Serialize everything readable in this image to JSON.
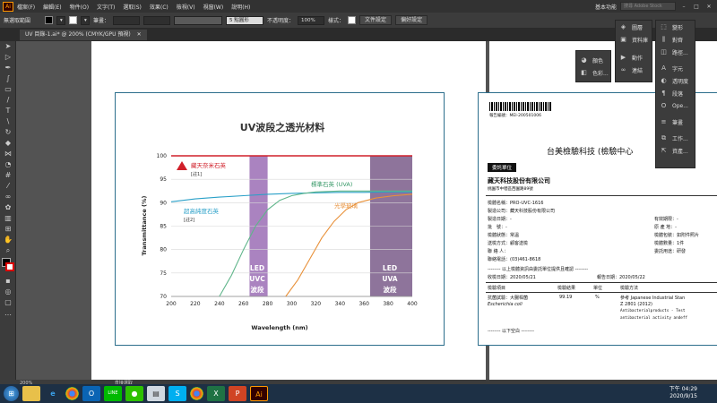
{
  "menubar": {
    "logo": "Ai",
    "items": [
      "檔案(F)",
      "編輯(E)",
      "物件(O)",
      "文字(T)",
      "選取(S)",
      "效果(C)",
      "檢視(V)",
      "視窗(W)",
      "說明(H)"
    ],
    "workspace": "基本功能",
    "search_placeholder": "搜尋 Adobe Stock",
    "win_min": "–",
    "win_max": "□",
    "win_close": "✕"
  },
  "control_bar": {
    "selection_label": "無選取範圍",
    "stroke_label": "筆畫：",
    "brush_value": "5 點圓形",
    "opacity_label": "不透明度：",
    "opacity_value": "100%",
    "style_label": "樣式：",
    "doc_setup": "文件設定",
    "preferences": "偏好設定"
  },
  "document_tab": {
    "title": "UV 目錄-1.ai* @ 200% (CMYK/GPU 預視)",
    "close": "✕"
  },
  "status_bar": {
    "zoom": "200%",
    "tool": "直接選取"
  },
  "panels": {
    "top_dock": {
      "items": [
        {
          "icon": "layers-icon",
          "label": "圖層"
        },
        {
          "icon": "library-icon",
          "label": "資料庫"
        },
        {
          "icon": "actions-icon",
          "label": "動作"
        },
        {
          "icon": "links-icon",
          "label": "連結"
        }
      ]
    },
    "right_dock": {
      "items": [
        {
          "label": "變形"
        },
        {
          "label": "對齊"
        },
        {
          "label": "路徑..."
        },
        {
          "label": "字元"
        },
        {
          "label": "透明度"
        },
        {
          "label": "段落"
        },
        {
          "label": "Ope..."
        },
        {
          "label": "筆畫"
        },
        {
          "label": "工作..."
        },
        {
          "label": "資產..."
        }
      ]
    },
    "color_dock": {
      "items": [
        {
          "label": "顏色"
        },
        {
          "label": "色彩..."
        }
      ]
    }
  },
  "chart": {
    "title": "UV波段之透光材料",
    "xlabel": "Wavelength (nm)",
    "ylabel": "Transmittance (%)",
    "band1_lines": [
      "LED",
      "UVC",
      "波段"
    ],
    "band2_lines": [
      "LED",
      "UVA",
      "波段"
    ],
    "marker_label": "藏天奈米石英",
    "marker_note": "[註1]",
    "s2_label": "超高純度石英",
    "s2_note": "[註2]",
    "s3_label": "標準石英 (UVA)",
    "s4_label": "光學玻璃"
  },
  "chart_data": {
    "type": "line",
    "title": "UV波段之透光材料",
    "xlabel": "Wavelength (nm)",
    "ylabel": "Transmittance (%)",
    "xlim": [
      200,
      400
    ],
    "ylim": [
      70,
      100
    ],
    "xticks": [
      200,
      220,
      240,
      260,
      280,
      300,
      320,
      340,
      360,
      380,
      400
    ],
    "yticks": [
      70,
      75,
      80,
      85,
      90,
      95,
      100
    ],
    "shaded_bands": [
      {
        "name": "LED UVC 波段",
        "range": [
          265,
          280
        ],
        "color": "#9b6db5"
      },
      {
        "name": "LED UVA 波段",
        "range": [
          365,
          400
        ],
        "color": "#7a5c8a"
      }
    ],
    "series": [
      {
        "name": "藏天奈米石英",
        "color": "#d0202a",
        "x": [
          200,
          250,
          300,
          350,
          400
        ],
        "y": [
          100,
          100,
          100,
          100,
          100
        ]
      },
      {
        "name": "超高純度石英",
        "color": "#2aa0c8",
        "x": [
          200,
          220,
          240,
          260,
          280,
          300,
          320,
          340,
          360,
          380,
          400
        ],
        "y": [
          90.2,
          90.8,
          91.2,
          91.5,
          91.8,
          92.0,
          92.1,
          92.2,
          92.2,
          92.3,
          92.3
        ]
      },
      {
        "name": "標準石英 (UVA)",
        "color": "#5fb58a",
        "x": [
          240,
          250,
          260,
          270,
          280,
          290,
          300,
          310,
          320,
          340,
          360,
          400
        ],
        "y": [
          70,
          74.5,
          80,
          85,
          88.5,
          90.5,
          91.5,
          92,
          92.3,
          92.5,
          92.5,
          92.5
        ]
      },
      {
        "name": "光學玻璃",
        "color": "#e8913a",
        "x": [
          295,
          305,
          315,
          325,
          335,
          345,
          355,
          370,
          385,
          400
        ],
        "y": [
          70,
          73.5,
          78,
          82.5,
          86,
          88.5,
          90,
          91,
          91.5,
          91.8
        ]
      }
    ]
  },
  "report": {
    "barcode_text": "報告編號：MEI-200501006",
    "company_title": "台美檢驗科技 (檢驗中心",
    "title_suffix": "告",
    "client_tag": "委託單位",
    "client_name": "藏天科技股份有限公司",
    "client_address": "桃園市中壢區西園路89號",
    "fields_left": [
      "檢體名稱：PRO-UVC-1616",
      "製造公司：藏天科技股份有限公司",
      "製造日期：-",
      "批　號：-",
      "檢體狀態：常溫",
      "送檢方式：顧客送檢",
      "聯 絡 人：",
      "聯絡電話：(03)461-8618"
    ],
    "fields_right": [
      "有效期限：-",
      "原 產 地：-",
      "檢體包裝：如附件照片",
      "檢體數量：1件",
      "委託用途：研發"
    ],
    "divider1": "-------- 以上檢體資訊由委託單位提供且確認 --------",
    "receive_date": "收檢日期：2020/05/21",
    "report_date": "報告日期：2020/05/22",
    "table_headers": [
      "檢驗項目",
      "檢驗結果",
      "單位",
      "檢驗方法"
    ],
    "row1": [
      "抗菌試驗：大腸桿菌",
      "99.19",
      "%",
      "參考 Japanese Industrial Stan"
    ],
    "row1_sub": "Escherichia coli",
    "row1_method2": "Z 2801 (2012)",
    "row1_method3": "Antibacterialproducts - Test",
    "row1_method4": "antibacterial activity andeff",
    "end_note": "-------- 以下空白 --------"
  },
  "taskbar": {
    "time": "下午 04:29",
    "date": "2020/9/15"
  }
}
